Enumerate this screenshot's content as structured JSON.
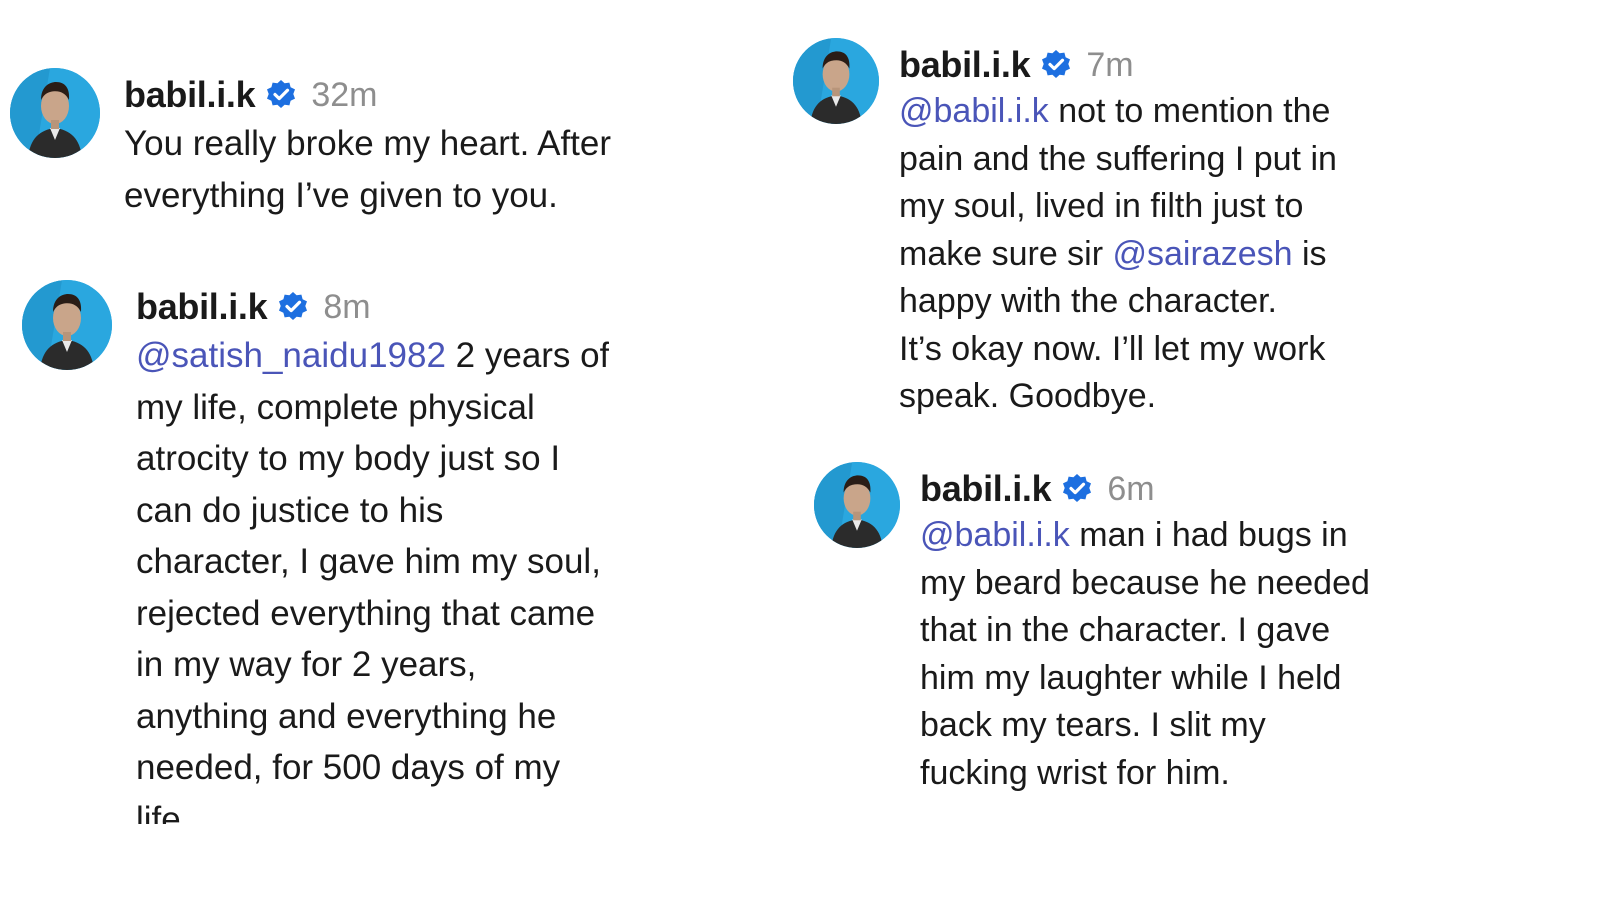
{
  "colors": {
    "mention": "#4a55b8",
    "verified_badge": "#1d6fe0",
    "timestamp": "#8e8e8e",
    "avatar_bg": "#2aa7df"
  },
  "comments": [
    {
      "username": "babil.i.k",
      "time": "32m",
      "avatar_icon": "profile-photo",
      "verified_icon": "verified-badge-icon",
      "lines": [
        {
          "mention": "",
          "text": "You really broke my heart. After"
        },
        {
          "mention": "",
          "text": "everything I’ve given to you."
        }
      ]
    },
    {
      "username": "babil.i.k",
      "time": "8m",
      "avatar_icon": "profile-photo",
      "verified_icon": "verified-badge-icon",
      "lines": [
        {
          "mention": "@satish_naidu1982",
          "text": " 2 years of"
        },
        {
          "mention": "",
          "text": "my life, complete physical"
        },
        {
          "mention": "",
          "text": "atrocity to my body just so I"
        },
        {
          "mention": "",
          "text": "can do justice to his"
        },
        {
          "mention": "",
          "text": "character, I gave him my soul,"
        },
        {
          "mention": "",
          "text": "rejected everything that came"
        },
        {
          "mention": "",
          "text": "in my way for 2 years,"
        },
        {
          "mention": "",
          "text": "anything and everything he"
        },
        {
          "mention": "",
          "text": "needed, for 500 days of my"
        },
        {
          "mention": "",
          "text": "life."
        }
      ]
    },
    {
      "username": "babil.i.k",
      "time": "7m",
      "avatar_icon": "profile-photo",
      "verified_icon": "verified-badge-icon",
      "lines": [
        {
          "mention": "@babil.i.k",
          "text": " not to mention the"
        },
        {
          "mention": "",
          "text": "pain and the suffering I put in"
        },
        {
          "mention": "",
          "text": "my soul, lived in filth just to"
        },
        {
          "pre": "make sure sir ",
          "mention": "@sairazesh",
          "text": " is"
        },
        {
          "mention": "",
          "text": "happy with the character."
        },
        {
          "mention": "",
          "text": "It’s okay now. I’ll let my work"
        },
        {
          "mention": "",
          "text": "speak. Goodbye."
        }
      ]
    },
    {
      "username": "babil.i.k",
      "time": "6m",
      "avatar_icon": "profile-photo",
      "verified_icon": "verified-badge-icon",
      "lines": [
        {
          "mention": "@babil.i.k",
          "text": " man i had bugs in"
        },
        {
          "mention": "",
          "text": "my beard because he needed"
        },
        {
          "mention": "",
          "text": "that in the character. I gave"
        },
        {
          "mention": "",
          "text": "him my laughter while I held"
        },
        {
          "mention": "",
          "text": "back my tears. I slit my"
        },
        {
          "mention": "",
          "text": "fucking wrist for him."
        }
      ]
    }
  ]
}
